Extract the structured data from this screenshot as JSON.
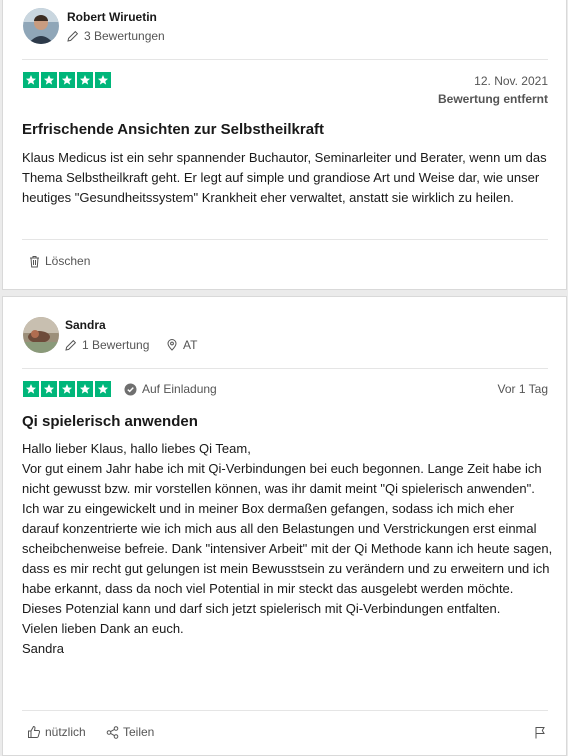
{
  "reviews": [
    {
      "author": "Robert Wiruetin",
      "review_count": "3 Bewertungen",
      "rating": 5,
      "date": "12. Nov. 2021",
      "status": "Bewertung entfernt",
      "title": "Erfrischende Ansichten zur Selbstheilkraft",
      "text": "Klaus Medicus ist ein sehr spannender Buchautor, Seminarleiter und Berater, wenn um das Thema Selbstheilkraft geht. Er legt auf simple und grandiose Art und Weise dar, wie unser heutiges \"Gesundheitssystem\" Krankheit eher verwaltet, anstatt sie wirklich zu heilen.",
      "delete_label": "Löschen"
    },
    {
      "author": "Sandra",
      "review_count": "1 Bewertung",
      "country": "AT",
      "rating": 5,
      "invited_label": "Auf Einladung",
      "date": "Vor 1 Tag",
      "title": "Qi spielerisch anwenden",
      "text_lines": [
        "Hallo lieber Klaus, hallo liebes Qi Team,",
        "Vor gut einem Jahr habe ich mit Qi-Verbindungen bei euch begonnen. Lange Zeit habe ich nicht gewusst bzw. mir vorstellen können, was ihr damit meint \"Qi spielerisch anwenden\". Ich war zu eingewickelt und in meiner Box dermaßen gefangen, sodass ich mich eher darauf konzentrierte wie ich mich aus all den Belastungen und Verstrickungen erst einmal scheibchenweise befreie. Dank \"intensiver Arbeit\" mit der Qi Methode kann ich heute sagen, dass es mir recht gut gelungen ist mein Bewusstsein zu verändern und zu erweitern und ich habe erkannt, dass da noch viel Potential in mir steckt das ausgelebt werden möchte. Dieses Potenzial kann und darf sich jetzt spielerisch mit Qi-Verbindungen entfalten.",
        "Vielen lieben Dank an euch.",
        "Sandra"
      ],
      "useful_label": "nützlich",
      "share_label": "Teilen"
    }
  ],
  "colors": {
    "star_green": "#00b67a",
    "text": "#191919",
    "muted": "#555555"
  },
  "icons": [
    "pencil-icon",
    "location-pin-icon",
    "verified-check-icon",
    "trash-icon",
    "thumbs-up-icon",
    "share-icon",
    "flag-icon",
    "star-icon"
  ]
}
